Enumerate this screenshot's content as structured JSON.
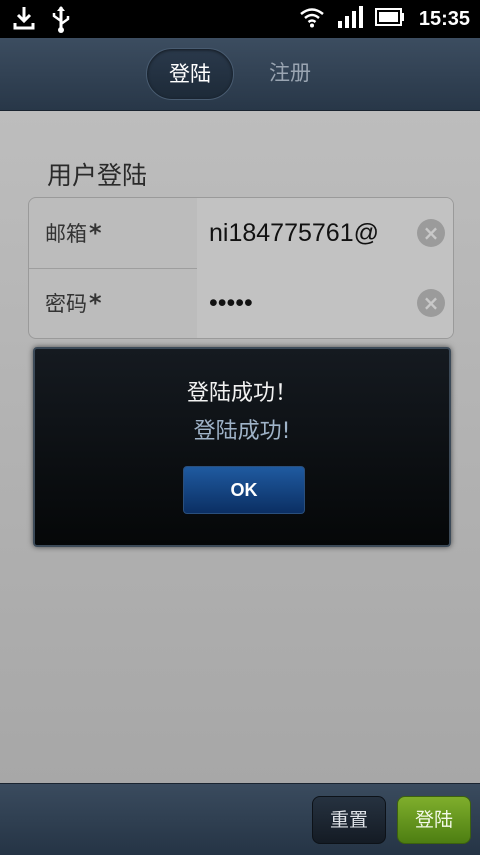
{
  "status_bar": {
    "time": "15:35",
    "icons": [
      "download-icon",
      "usb-icon",
      "wifi-icon",
      "signal-icon",
      "battery-icon"
    ]
  },
  "tabs": [
    {
      "label": "登陆"
    },
    {
      "label": "注册"
    }
  ],
  "form": {
    "title": "用户登陆",
    "email_label": "邮箱",
    "password_label": "密码",
    "required_mark": "*",
    "email_value": "ni184775761@",
    "password_value": "•••••"
  },
  "dialog": {
    "title": "登陆成功！",
    "message": "登陆成功!",
    "ok_label": "OK"
  },
  "bottom_bar": {
    "reset_label": "重置",
    "login_label": "登陆"
  },
  "colors": {
    "accent_green": "#6a9c20",
    "dialog_button_blue": "#1f5aa0",
    "tab_bar": "#2f3f51"
  }
}
